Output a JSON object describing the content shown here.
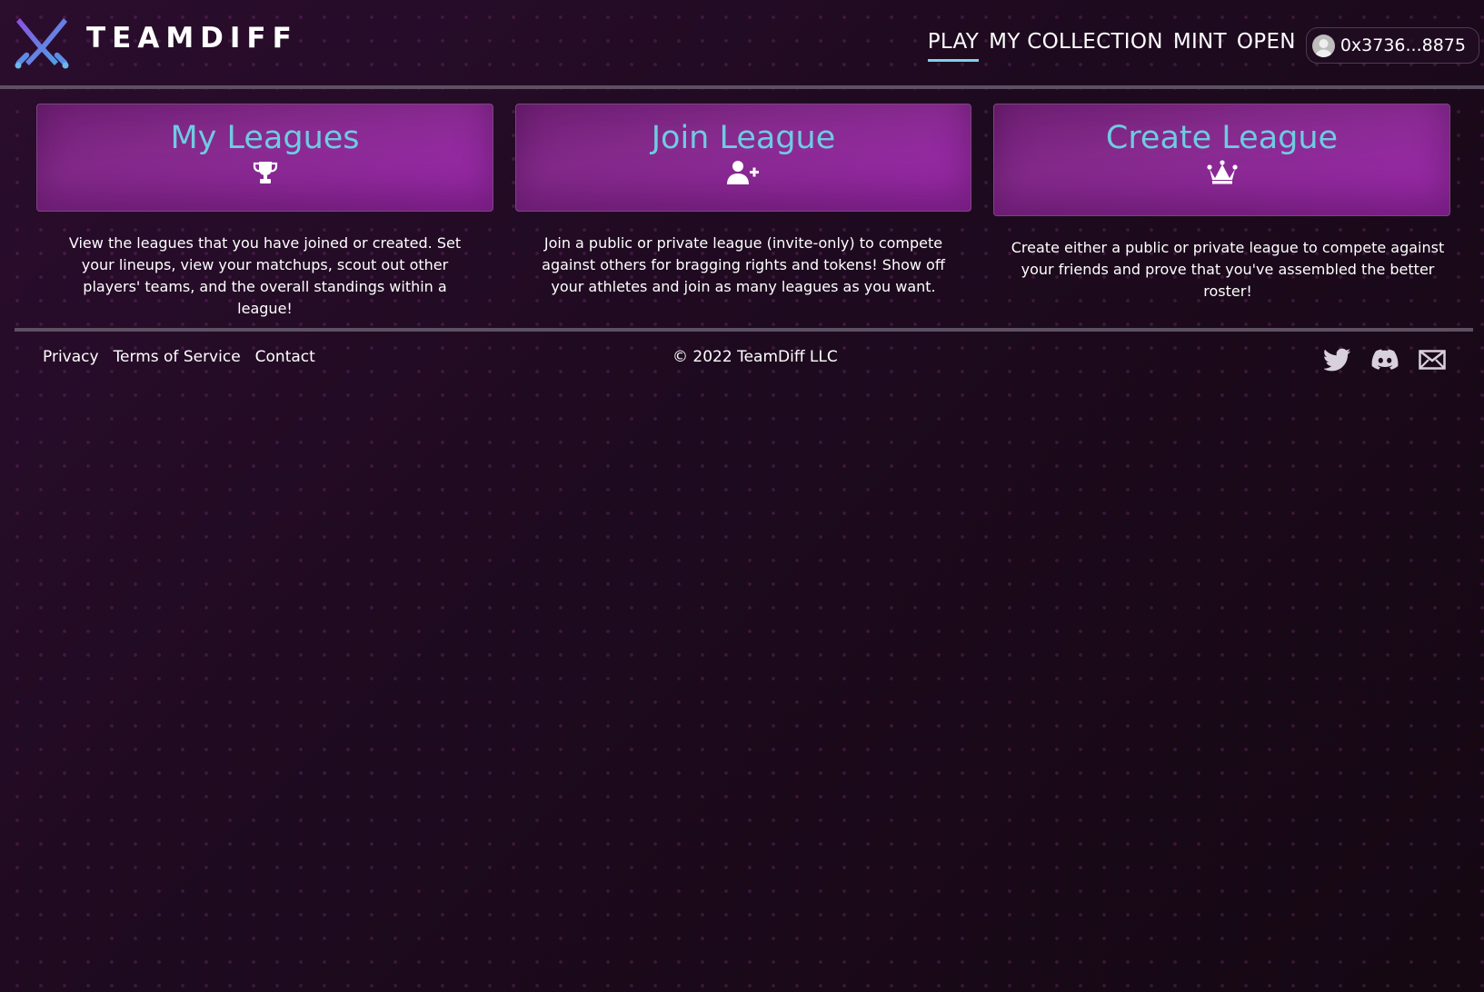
{
  "header": {
    "brand": "TEAMDIFF",
    "nav": [
      {
        "label": "PLAY",
        "active": true
      },
      {
        "label": "MY COLLECTION",
        "active": false
      },
      {
        "label": "MINT",
        "active": false
      },
      {
        "label": "OPEN",
        "active": false
      }
    ],
    "wallet": "0x3736...8875"
  },
  "cards": [
    {
      "title": "My Leagues",
      "icon": "trophy-icon",
      "description": "View the leagues that you have joined or created. Set your lineups, view your matchups, scout out other players' teams, and the overall standings within a league!"
    },
    {
      "title": "Join League",
      "icon": "user-plus-icon",
      "description": "Join a public or private league (invite-only) to compete against others for bragging rights and tokens! Show off your athletes and join as many leagues as you want."
    },
    {
      "title": "Create League",
      "icon": "crown-icon",
      "description": "Create either a public or private league to compete against your friends and prove that you've assembled the better roster!"
    }
  ],
  "footer": {
    "links": [
      "Privacy",
      "Terms of Service",
      "Contact"
    ],
    "copyright": "© 2022 TeamDiff LLC",
    "social": [
      "twitter-icon",
      "discord-icon",
      "email-icon"
    ]
  },
  "colors": {
    "background": "#1f0a20",
    "card_gradient_start": "#6e1f73",
    "card_gradient_end": "#a02ab0",
    "title_text": "#6fcbe1",
    "active_underline": "#7fd0e8",
    "rule": "#5e5063"
  }
}
